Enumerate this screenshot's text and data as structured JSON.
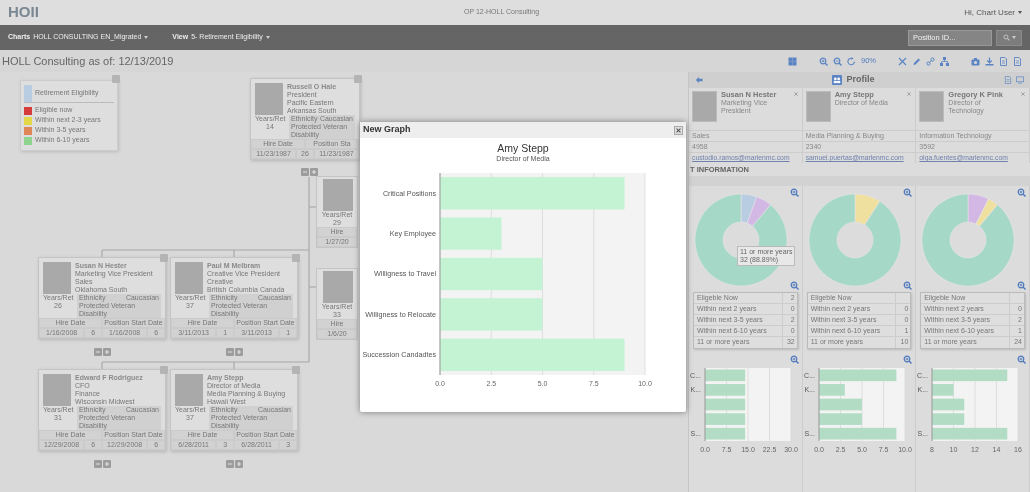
{
  "header": {
    "logo": "HOII",
    "title": "OP 12-HOLL Consulting",
    "user": "Hi, Chart User"
  },
  "navbar": {
    "menus": [
      {
        "label": "Charts",
        "value": "HOLL CONSULTING EN_Migrated"
      },
      {
        "label": "View",
        "value": "5- Retirement Eligibility"
      }
    ],
    "search": {
      "placeholder": "Position ID..."
    }
  },
  "page_title": "HOLL Consulting as of: 12/13/2019",
  "toolbar": {
    "zoom_level": "90%"
  },
  "legend": {
    "title": "Retirement Eligibility",
    "items": [
      {
        "label": "Eligible now",
        "color": "#d63c3c"
      },
      {
        "label": "Within next 2-3 years",
        "color": "#e3d84a"
      },
      {
        "label": "Within 3-5 years",
        "color": "#e0875a"
      },
      {
        "label": "Within 6-10 years",
        "color": "#8fd48f"
      }
    ]
  },
  "org_cards": [
    {
      "name": "Russell O Hale",
      "lines": [
        "President",
        "Pacific Eastern",
        "Arkansas South"
      ],
      "ethnicity_label": "Ethnicity",
      "ethnicity": "Caucasian",
      "veteran": "Protected Veteran",
      "disability": "Disability",
      "years_label": "Years/Ret",
      "years": "14",
      "hire_label": "Hire Date",
      "start_label": "Position Sta",
      "hire_date": "11/23/1987",
      "hire_years": "26",
      "start_date": "11/23/1987"
    },
    {
      "name": "Susan N Hester",
      "lines": [
        "Marketing Vice President",
        "Sales",
        "Oklahoma South"
      ],
      "ethnicity_label": "Ethnicity",
      "ethnicity": "Caucasian",
      "veteran": "Protected Veteran",
      "disability": "Disability",
      "years_label": "Years/Ret",
      "years": "26",
      "hire_label": "Hire Date",
      "start_label": "Position Start Date",
      "hire_date": "1/16/2008",
      "hire_years": "6",
      "start_date": "1/16/2008",
      "start_years": "6"
    },
    {
      "name": "Paul M Melbram",
      "lines": [
        "Creative Vice President",
        "Creative",
        "British Columbia Canada"
      ],
      "ethnicity_label": "Ethnicity",
      "ethnicity": "Caucasian",
      "veteran": "Protected Veteran",
      "disability": "Disability",
      "years_label": "Years/Ret",
      "years": "37",
      "hire_label": "Hire Date",
      "start_label": "Position Start Date",
      "hire_date": "3/11/2013",
      "hire_years": "1",
      "start_date": "3/11/2013",
      "start_years": "1"
    },
    {
      "name": "Edward F Rodriguez",
      "lines": [
        "CFO",
        "Finance",
        "Wisconsin Midwest"
      ],
      "ethnicity_label": "Ethnicity",
      "ethnicity": "Caucasian",
      "veteran": "Protected Veteran",
      "disability": "Disability",
      "years_label": "Years/Ret",
      "years": "31",
      "hire_label": "Hire Date",
      "start_label": "Position Start Date",
      "hire_date": "12/29/2008",
      "hire_years": "6",
      "start_date": "12/29/2008",
      "start_years": "6"
    },
    {
      "name": "Amy Stepp",
      "lines": [
        "Director of Media",
        "Media Planning & Buying",
        "Hawaii West"
      ],
      "ethnicity_label": "Ethnicity",
      "ethnicity": "Caucasian",
      "veteran": "Protected Veteran",
      "disability": "Disability",
      "years_label": "Years/Ret",
      "years": "37",
      "hire_label": "Hire Date",
      "start_label": "Position Start Date",
      "hire_date": "6/28/2011",
      "hire_years": "3",
      "start_date": "6/28/2011",
      "start_years": "3"
    }
  ],
  "partial_cards": [
    {
      "years_label": "Years/Ret",
      "years": "29",
      "hire_label": "Hire",
      "hire_date": "1/27/20"
    },
    {
      "years_label": "Years/Ret",
      "years": "33",
      "hire_label": "Hire",
      "hire_date": "1/6/20"
    }
  ],
  "modal": {
    "title": "New Graph",
    "subtitle": "Director of Media",
    "chart_data": {
      "type": "bar",
      "grid": true,
      "orientation": "horizontal",
      "title": "Amy Stepp",
      "categories": [
        "Critical Positions",
        "Key Employee",
        "Willigness to Travel",
        "Willigness to Relocate",
        "Succession Candadtes"
      ],
      "values": [
        9,
        3,
        5,
        5,
        9
      ],
      "xlim": [
        0,
        10
      ],
      "xticks": [
        {
          "value": 0,
          "label": "0.0"
        },
        {
          "value": 2.5,
          "label": "2.5"
        },
        {
          "value": 5,
          "label": "5.0"
        },
        {
          "value": 7.5,
          "label": "7.5"
        },
        {
          "value": 10,
          "label": "10.0"
        }
      ]
    }
  },
  "profile": {
    "title": "Profile",
    "people": [
      {
        "name": "Susan N Hester",
        "title": "Marketing Vice President",
        "department": "Sales",
        "extension": "4958",
        "email": "custodio.ramos@marlenmc.com"
      },
      {
        "name": "Amy Stepp",
        "title": "Director of Media",
        "department": "Media Planning & Buying",
        "extension": "2340",
        "email": "samuel.puertas@marlenmc.com"
      },
      {
        "name": "Gregory K Pink",
        "title": "Director of Technology",
        "department": "Information Technology",
        "extension": "3592",
        "email": "olga.fuentes@marlenmc.com"
      }
    ]
  },
  "information": {
    "title": "T INFORMATION",
    "columns": [
      {
        "tooltip": [
          "11 or more years",
          "32 (88.89%)"
        ],
        "table": [
          {
            "label": "Eligeble Now",
            "value": "2"
          },
          {
            "label": "Within next 2 years",
            "value": "0"
          },
          {
            "label": "Within next 3-5 years",
            "value": "2"
          },
          {
            "label": "Within next 6-10 years",
            "value": "0"
          },
          {
            "label": "11 or more years",
            "value": "32"
          }
        ],
        "chart_data": {
          "type": "bar",
          "grid": true,
          "orientation": "horizontal",
          "categories": [
            "C...",
            "K...",
            null,
            null,
            "S..."
          ],
          "values": [
            14,
            14,
            14,
            14,
            14
          ],
          "xlim": [
            0,
            30
          ],
          "xticks": [
            {
              "value": 0,
              "label": "0.0"
            },
            {
              "value": 7.5,
              "label": "7.5"
            },
            {
              "value": 15,
              "label": "15.0"
            },
            {
              "value": 22.5,
              "label": "22.5"
            },
            {
              "value": 30,
              "label": "30.0"
            }
          ]
        }
      },
      {
        "table": [
          {
            "label": "Eligeble Now"
          },
          {
            "label": "Within next 2 years",
            "value": "0"
          },
          {
            "label": "Within next 3-5 years",
            "value": "0"
          },
          {
            "label": "Within next 6-10 years",
            "value": "1"
          },
          {
            "label": "11 or more years",
            "value": "10"
          }
        ],
        "chart_data": {
          "type": "bar",
          "grid": true,
          "orientation": "horizontal",
          "categories": [
            "C...",
            "K...",
            null,
            null,
            "S..."
          ],
          "values": [
            9,
            3,
            5,
            5,
            9
          ],
          "xlim": [
            0,
            10
          ],
          "xticks": [
            {
              "value": 0,
              "label": "0.0"
            },
            {
              "value": 2.5,
              "label": "2.5"
            },
            {
              "value": 5,
              "label": "5.0"
            },
            {
              "value": 7.5,
              "label": "7.5"
            },
            {
              "value": 10,
              "label": "10.0"
            }
          ]
        }
      },
      {
        "table": [
          {
            "label": "Eligeble Now"
          },
          {
            "label": "Within next 2 years",
            "value": "0"
          },
          {
            "label": "Within next 3-5 years",
            "value": "2"
          },
          {
            "label": "Within next 6-10 years",
            "value": "1"
          },
          {
            "label": "11 or more years",
            "value": "24"
          }
        ],
        "chart_data": {
          "type": "bar",
          "grid": true,
          "orientation": "horizontal",
          "categories": [
            "C...",
            "K...",
            null,
            null,
            "S..."
          ],
          "values": [
            15,
            10,
            11,
            11,
            15
          ],
          "xlim": [
            8,
            16
          ],
          "xticks": [
            8,
            10,
            12,
            14,
            16
          ]
        }
      }
    ]
  }
}
